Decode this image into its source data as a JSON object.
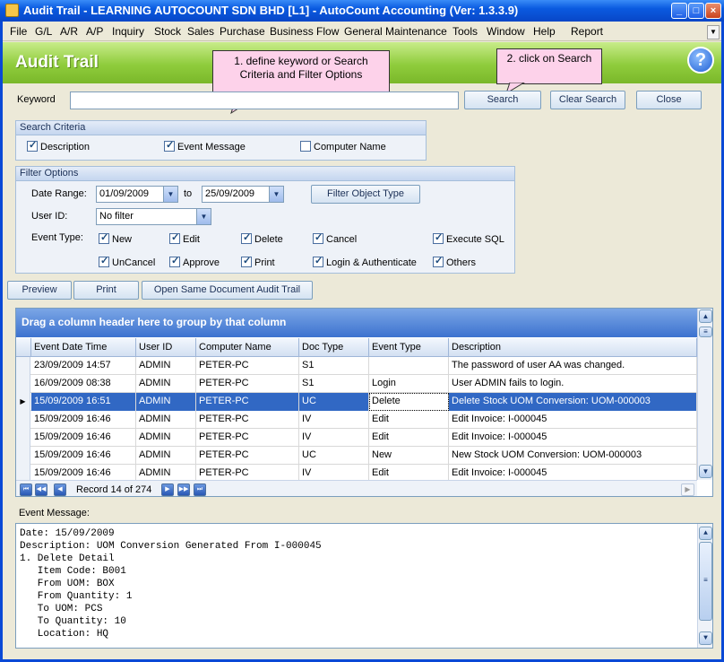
{
  "window": {
    "title": "Audit Trail - LEARNING AUTOCOUNT SDN BHD [L1] - AutoCount Accounting (Ver: 1.3.3.9)"
  },
  "menu": [
    "File",
    "G/L",
    "A/R",
    "A/P",
    "Inquiry",
    "Stock",
    "Sales",
    "Purchase",
    "Business Flow",
    "General Maintenance",
    "Tools",
    "Window",
    "Help",
    "Report"
  ],
  "banner": {
    "title": "Audit Trail",
    "help": "?"
  },
  "callouts": {
    "first": "1. define keyword or Search Criteria and Filter Options",
    "second": "2. click on Search"
  },
  "keyword": {
    "label": "Keyword",
    "value": ""
  },
  "buttons": {
    "search": "Search",
    "clear": "Clear Search",
    "close": "Close",
    "filter_object": "Filter Object Type",
    "preview": "Preview",
    "print": "Print",
    "open_same": "Open Same Document Audit Trail"
  },
  "search_criteria": {
    "title": "Search Criteria",
    "options": [
      {
        "label": "Description",
        "checked": true
      },
      {
        "label": "Event Message",
        "checked": true
      },
      {
        "label": "Computer Name",
        "checked": false
      }
    ]
  },
  "filter_options": {
    "title": "Filter Options",
    "date_range_label": "Date Range:",
    "date_from": "01/09/2009",
    "to_label": "to",
    "date_to": "25/09/2009",
    "user_label": "User ID:",
    "user_value": "No filter",
    "event_type_label": "Event Type:",
    "event_types": [
      "New",
      "Edit",
      "Delete",
      "Cancel",
      "Execute SQL",
      "UnCancel",
      "Approve",
      "Print",
      "Login & Authenticate",
      "Others"
    ]
  },
  "grid": {
    "group_hint": "Drag a column header here to group by that column",
    "columns": [
      "Event Date Time",
      "User ID",
      "Computer Name",
      "Doc Type",
      "Event Type",
      "Description"
    ],
    "rows": [
      [
        "23/09/2009 14:57",
        "ADMIN",
        "PETER-PC",
        "S1",
        "",
        "The password of user AA was changed."
      ],
      [
        "16/09/2009 08:38",
        "ADMIN",
        "PETER-PC",
        "S1",
        "Login",
        "User ADMIN fails to login."
      ],
      [
        "15/09/2009 16:51",
        "ADMIN",
        "PETER-PC",
        "UC",
        "Delete",
        "Delete Stock UOM Conversion: UOM-000003"
      ],
      [
        "15/09/2009 16:46",
        "ADMIN",
        "PETER-PC",
        "IV",
        "Edit",
        "Edit Invoice: I-000045"
      ],
      [
        "15/09/2009 16:46",
        "ADMIN",
        "PETER-PC",
        "IV",
        "Edit",
        "Edit Invoice: I-000045"
      ],
      [
        "15/09/2009 16:46",
        "ADMIN",
        "PETER-PC",
        "UC",
        "New",
        "New Stock UOM Conversion: UOM-000003"
      ],
      [
        "15/09/2009 16:46",
        "ADMIN",
        "PETER-PC",
        "IV",
        "Edit",
        "Edit Invoice: I-000045"
      ]
    ],
    "selected_row": 2,
    "record_text": "Record 14 of 274"
  },
  "event_message": {
    "label": "Event Message:",
    "lines": [
      "Date: 15/09/2009",
      "Description: UOM Conversion Generated From I-000045",
      "1. Delete Detail",
      "   Item Code: B001",
      "   From UOM: BOX",
      "   From Quantity: 1",
      "   To UOM: PCS",
      "   To Quantity: 10",
      "   Location: HQ"
    ]
  }
}
